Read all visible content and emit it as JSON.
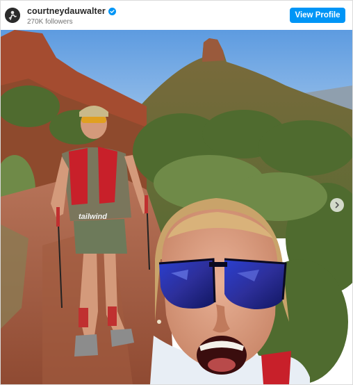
{
  "profile": {
    "username": "courtneydauwalter",
    "followers": "270K followers",
    "view_profile_label": "View Profile",
    "verified": true,
    "avatar_icon": "runner-silhouette-icon"
  },
  "post": {
    "shirt_text": "tailwind",
    "next_icon": "chevron-right-icon"
  },
  "colors": {
    "accent": "#0095f6",
    "verified": "#0095f6",
    "sky": "#6fa8e6",
    "red_rock": "#a0492e"
  }
}
